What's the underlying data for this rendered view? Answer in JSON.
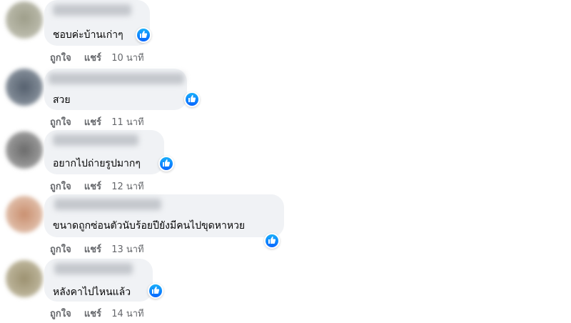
{
  "colors": {
    "bubble": "#f0f2f5",
    "meta_text": "#65676b",
    "like_blue": "#0866ff"
  },
  "comments": [
    {
      "text": "ชอบค่ะบ้านเก่าๆ",
      "like_label": "ถูกใจ",
      "share_label": "แชร์",
      "time": "10 นาที",
      "reaction_icon": "thumbs-up-icon"
    },
    {
      "text": "สวย",
      "like_label": "ถูกใจ",
      "share_label": "แชร์",
      "time": "11 นาที",
      "reaction_icon": "thumbs-up-icon"
    },
    {
      "text": "อยากไปถ่ายรูปมากๆ",
      "like_label": "ถูกใจ",
      "share_label": "แชร์",
      "time": "12 นาที",
      "reaction_icon": "thumbs-up-icon"
    },
    {
      "text": "ขนาดถูกซ่อนตัวนับร้อยปียังมีคนไปขุดหาหวย",
      "like_label": "ถูกใจ",
      "share_label": "แชร์",
      "time": "13 นาที",
      "reaction_icon": "thumbs-up-icon"
    },
    {
      "text": "หลังคาไปไหนแล้ว",
      "like_label": "ถูกใจ",
      "share_label": "แชร์",
      "time": "14 นาที",
      "reaction_icon": "thumbs-up-icon"
    }
  ]
}
